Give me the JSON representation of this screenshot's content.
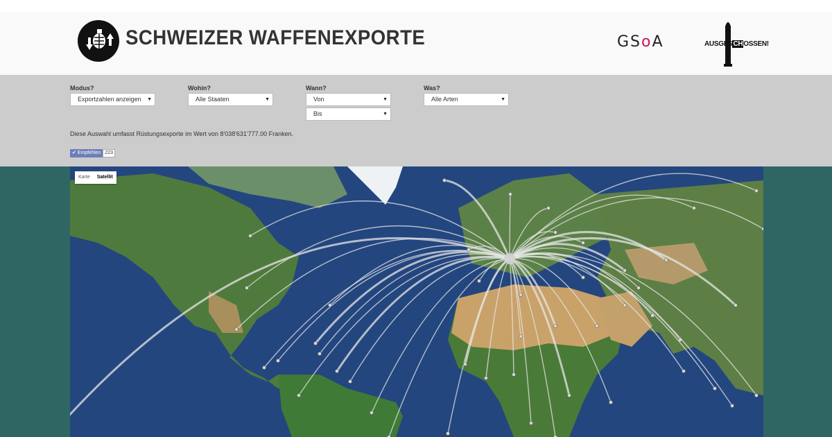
{
  "header": {
    "title": "SCHWEIZER WAFFENEXPORTE",
    "partner1": "GSoA",
    "partner2": "AUSGESCHOSSEN!"
  },
  "filters": {
    "modus": {
      "label": "Modus?",
      "value": "Exportzahlen anzeigen"
    },
    "wohin": {
      "label": "Wohin?",
      "value": "Alle Staaten"
    },
    "wann": {
      "label": "Wann?",
      "from": "Von",
      "to": "Bis"
    },
    "was": {
      "label": "Was?",
      "value": "Alle Arten"
    }
  },
  "summary": "Diese Auswahl umfasst Rüstungsexporte im Wert von 8'038'631'777.00 Franken.",
  "recommend": {
    "label": "Empfehlen",
    "count": "223"
  },
  "map": {
    "type_toggle": [
      "Karte",
      "Satellit"
    ],
    "active_type": "Satellit"
  },
  "colors": {
    "header_bg": "#f9f9f9",
    "filter_bg": "#cccccc",
    "page_bg": "#2f6664",
    "ocean": "#2a4f8c",
    "land": "#4d7a3a",
    "desert": "#c9a26a",
    "arc": "#e6e6e6",
    "accent": "#c2185b"
  }
}
